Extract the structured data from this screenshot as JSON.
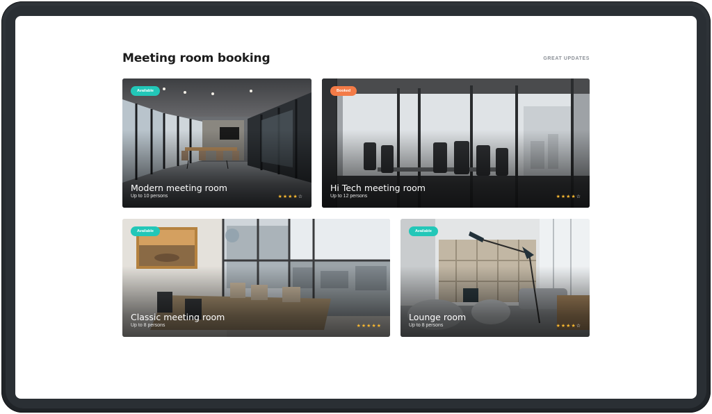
{
  "page": {
    "title": "Meeting room booking",
    "updates_label": "GREAT UPDATES"
  },
  "colors": {
    "available": "#22c7b8",
    "booked": "#f37b47",
    "star": "#f7b731"
  },
  "rooms": [
    {
      "name": "Modern meeting room",
      "capacity": "Up to 10 persons",
      "status": "Available",
      "rating": 4,
      "rating_max": 5
    },
    {
      "name": "Hi Tech meeting room",
      "capacity": "Up to 12 persons",
      "status": "Booked",
      "rating": 4,
      "rating_max": 5
    },
    {
      "name": "Classic meeting room",
      "capacity": "Up to 8 persons",
      "status": "Available",
      "rating": 5,
      "rating_max": 5
    },
    {
      "name": "Lounge room",
      "capacity": "Up to 8 persons",
      "status": "Available",
      "rating": 4,
      "rating_max": 5
    }
  ]
}
